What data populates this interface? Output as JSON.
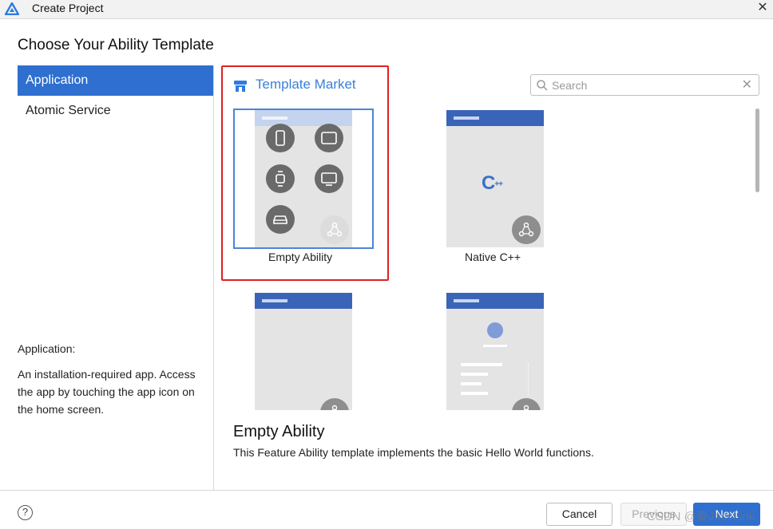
{
  "window": {
    "title": "Create Project",
    "close_glyph": "✕"
  },
  "heading": "Choose Your Ability Template",
  "sidebar": {
    "items": [
      {
        "label": "Application",
        "active": true
      },
      {
        "label": "Atomic Service",
        "active": false
      }
    ],
    "description_title": "Application:",
    "description": "An installation-required app. Access the app by touching the app icon on the home screen."
  },
  "market": {
    "label": "Template Market",
    "icon": "store-icon"
  },
  "search": {
    "placeholder": "Search",
    "value": "",
    "clear_glyph": "✕"
  },
  "templates": [
    {
      "label": "Empty Ability",
      "selected": true,
      "icons": [
        "phone-icon",
        "tablet-icon",
        "watch-icon",
        "tv-icon",
        "car-icon",
        "hub-icon"
      ]
    },
    {
      "label": "Native C++",
      "selected": false,
      "badge": "C++",
      "icons": [
        "hub-icon"
      ]
    },
    {
      "label": "",
      "selected": false,
      "icons": [
        "hub-icon"
      ]
    },
    {
      "label": "",
      "selected": false,
      "icons": [
        "avatar-icon",
        "list-lines",
        "hub-icon"
      ]
    }
  ],
  "detail": {
    "title": "Empty Ability",
    "description": "This Feature Ability template implements the basic Hello World functions."
  },
  "footer": {
    "help_glyph": "?",
    "cancel_label": "Cancel",
    "previous_label": "Previous",
    "next_label": "Next"
  },
  "watermark": "CSDN @秦JaccLink",
  "colors": {
    "accent": "#2e6fcf",
    "market_text": "#3a80d6",
    "highlight_box": "#e02020",
    "thumb_bar": "#3a64b8"
  }
}
